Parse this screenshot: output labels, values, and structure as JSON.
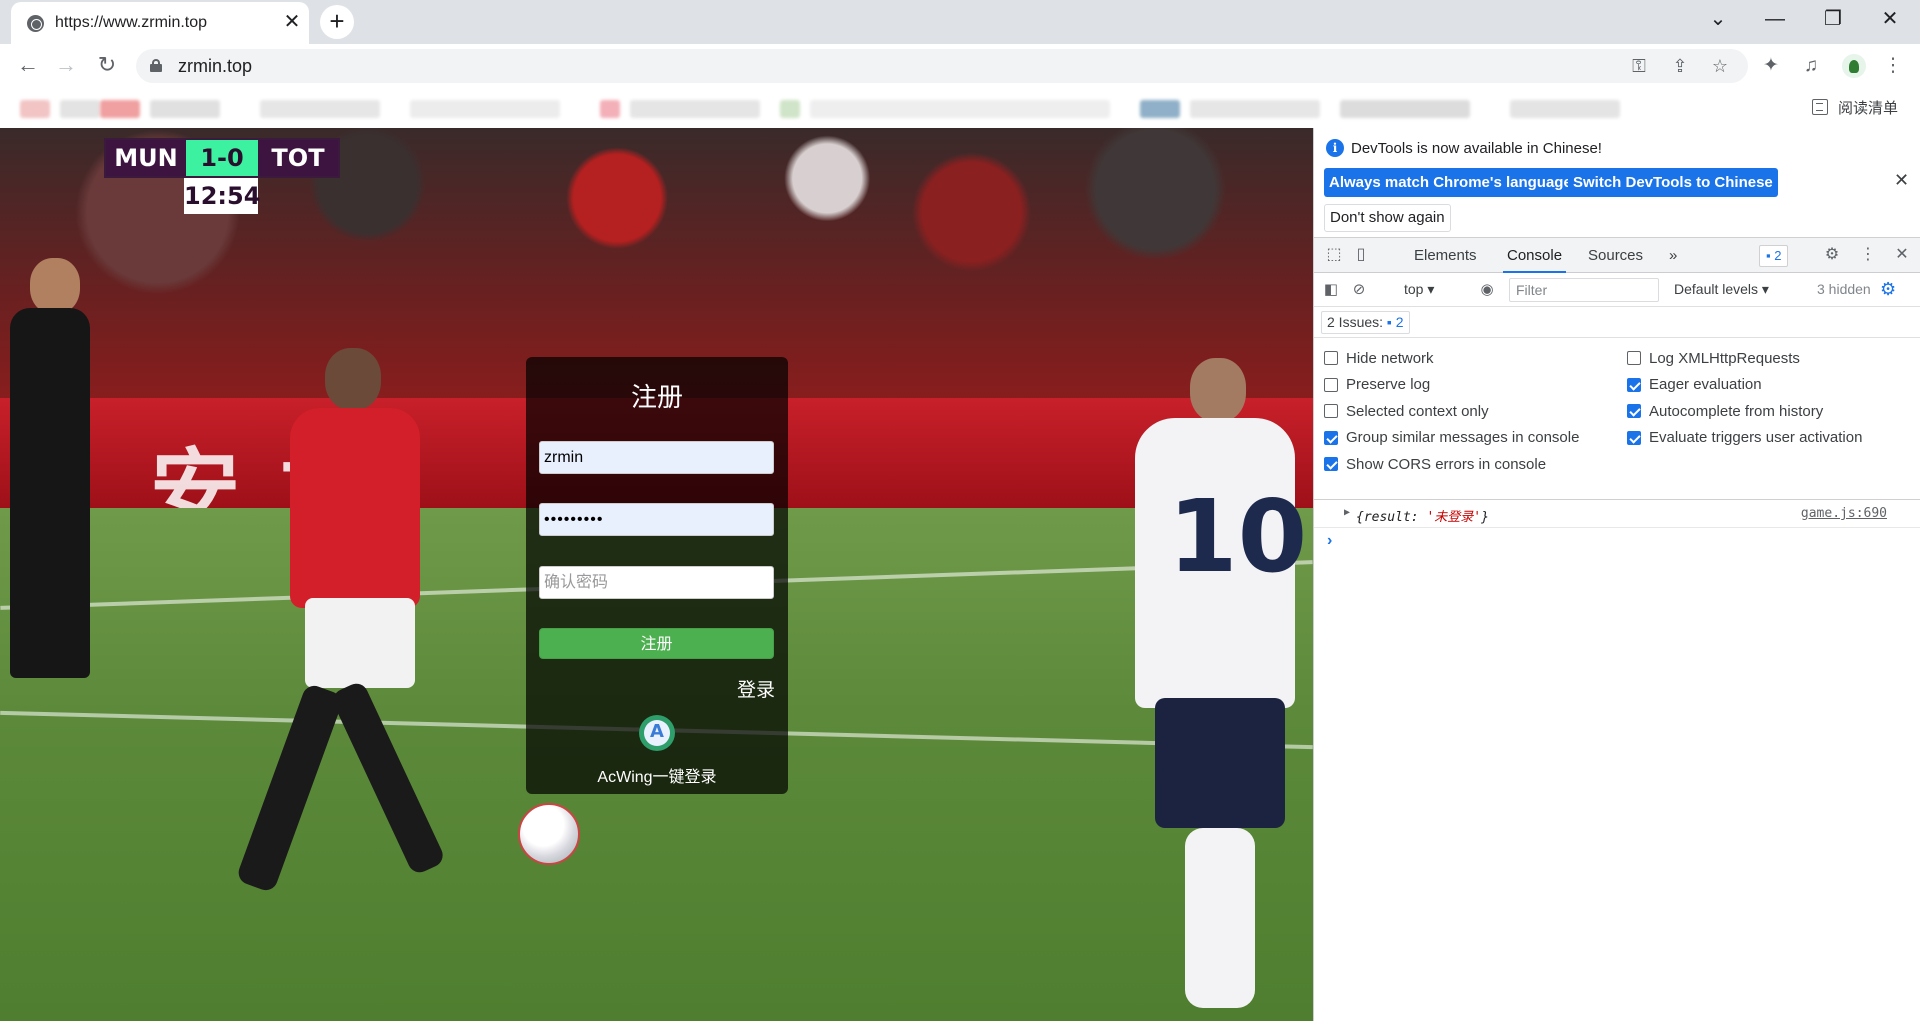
{
  "browser": {
    "tab_title": "https://www.zrmin.top",
    "tab_close": "✕",
    "new_tab": "+",
    "url": "zrmin.top",
    "reading_list": "阅读清单",
    "window_controls": {
      "minimize": "—",
      "maximize": "❐",
      "close": "✕",
      "tab_search": "⌄"
    }
  },
  "page": {
    "scoreboard": {
      "home": "MUN",
      "score": "1-0",
      "away": "TOT",
      "clock": "12:54"
    },
    "form": {
      "title": "注册",
      "username_value": "zrmin",
      "password_value": "•••••••••",
      "confirm_placeholder": "确认密码",
      "submit_label": "注册",
      "login_link": "登录",
      "acwing_label": "AcWing一键登录"
    }
  },
  "devtools": {
    "banner": {
      "message": "DevTools is now available in Chinese!",
      "btn_match": "Always match Chrome's language",
      "btn_switch": "Switch DevTools to Chinese",
      "btn_dismiss": "Don't show again"
    },
    "tabs": [
      "Elements",
      "Console",
      "Sources"
    ],
    "active_tab": "Console",
    "more_tabs": "»",
    "issues_count": "2",
    "console": {
      "context": "top ▾",
      "filter_placeholder": "Filter",
      "levels": "Default levels ▾",
      "hidden": "3 hidden",
      "issues_label": "2 Issues:",
      "issues_count": "2"
    },
    "settings_left": [
      {
        "label": "Hide network",
        "checked": false
      },
      {
        "label": "Preserve log",
        "checked": false
      },
      {
        "label": "Selected context only",
        "checked": false
      },
      {
        "label": "Group similar messages in console",
        "checked": true
      },
      {
        "label": "Show CORS errors in console",
        "checked": true
      }
    ],
    "settings_right": [
      {
        "label": "Log XMLHttpRequests",
        "checked": false
      },
      {
        "label": "Eager evaluation",
        "checked": true
      },
      {
        "label": "Autocomplete from history",
        "checked": true
      },
      {
        "label": "Evaluate triggers user activation",
        "checked": true
      }
    ],
    "log": {
      "prefix": "{result: ",
      "value": "'未登录'",
      "suffix": "}",
      "source": "game.js:690"
    },
    "prompt": "›"
  }
}
